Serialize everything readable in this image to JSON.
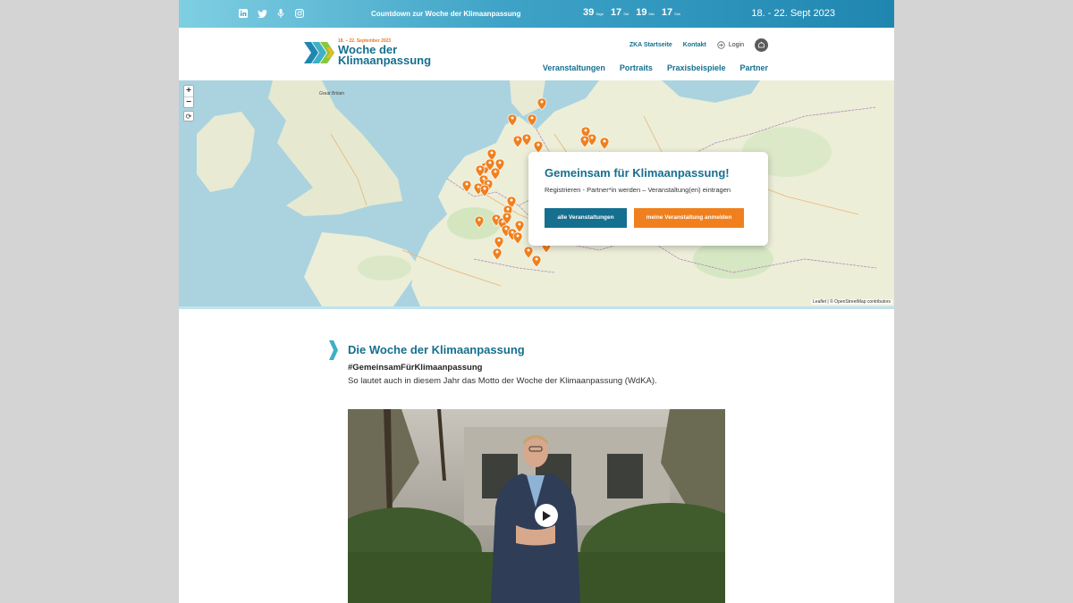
{
  "topbar": {
    "social_icons": [
      "linkedin-icon",
      "twitter-icon",
      "podcast-icon",
      "instagram-icon"
    ],
    "countdown_label": "Countdown zur Woche der Klimaanpassung",
    "countdown": [
      {
        "value": "39",
        "unit": "Tage"
      },
      {
        "value": "17",
        "unit": "Std"
      },
      {
        "value": "19",
        "unit": "Min"
      },
      {
        "value": "17",
        "unit": "Sek"
      }
    ],
    "event_dates": "18. - 22. Sept 2023"
  },
  "header": {
    "logo": {
      "date": "18. – 22. September 2023",
      "line1": "Woche der",
      "line2": "Klimaanpassung"
    },
    "utility_nav": {
      "home": "ZKA Startseite",
      "contact": "Kontakt",
      "login": "Login"
    },
    "main_nav": [
      "Veranstaltungen",
      "Portraits",
      "Praxisbeispiele",
      "Partner"
    ]
  },
  "map": {
    "zoom_in": "+",
    "zoom_out": "−",
    "labels": {
      "great_britain": "Great Britain"
    },
    "attribution": "Leaflet | © OpenStreetMap contributors"
  },
  "card": {
    "title": "Gemeinsam für Klimaanpassung!",
    "subtitle": "Registrieren - Partner*in werden – Veranstaltung(en) eintragen",
    "btn_all": "alle Veranstaltungen",
    "btn_register": "meine Veranstaltung anmelden"
  },
  "content": {
    "title": "Die Woche der Klimaanpassung",
    "hashtag": "#GemeinsamFürKlimaanpassung",
    "motto": "So lautet auch in diesem Jahr das Motto der Woche der Klimaanpassung (WdKA)."
  },
  "colors": {
    "brand_blue": "#156f8f",
    "accent_orange": "#f0801e"
  }
}
